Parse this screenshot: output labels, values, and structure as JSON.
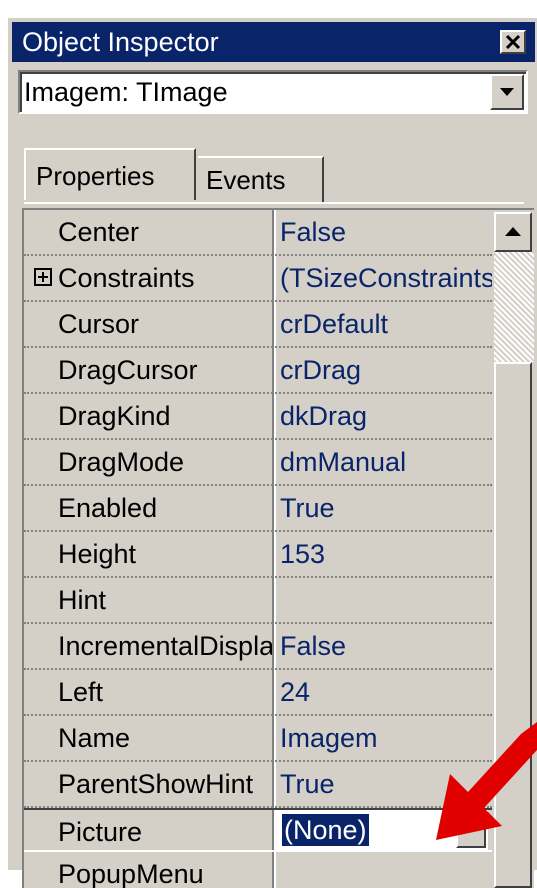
{
  "window": {
    "title": "Object Inspector",
    "close_glyph": "x"
  },
  "object_selector": {
    "value": "Imagem: TImage"
  },
  "tabs": [
    {
      "label": "Properties",
      "active": true
    },
    {
      "label": "Events",
      "active": false
    }
  ],
  "properties": [
    {
      "name": "Center",
      "value": "False",
      "expandable": false
    },
    {
      "name": "Constraints",
      "value": "(TSizeConstraints)",
      "expandable": true
    },
    {
      "name": "Cursor",
      "value": "crDefault",
      "expandable": false
    },
    {
      "name": "DragCursor",
      "value": "crDrag",
      "expandable": false
    },
    {
      "name": "DragKind",
      "value": "dkDrag",
      "expandable": false
    },
    {
      "name": "DragMode",
      "value": "dmManual",
      "expandable": false
    },
    {
      "name": "Enabled",
      "value": "True",
      "expandable": false
    },
    {
      "name": "Height",
      "value": "153",
      "expandable": false
    },
    {
      "name": "Hint",
      "value": "",
      "expandable": false
    },
    {
      "name": "IncrementalDisplay",
      "value": "False",
      "expandable": false
    },
    {
      "name": "Left",
      "value": "24",
      "expandable": false
    },
    {
      "name": "Name",
      "value": "Imagem",
      "expandable": false
    },
    {
      "name": "ParentShowHint",
      "value": "True",
      "expandable": false
    },
    {
      "name": "Picture",
      "value": "(None)",
      "expandable": false,
      "selected": true
    },
    {
      "name": "PopupMenu",
      "value": "",
      "expandable": false
    }
  ],
  "colors": {
    "titlebar": "#0a246a",
    "face": "#d4d0c8",
    "value_text": "#0a246a",
    "arrow": "#e00000"
  },
  "icons": [
    "close-icon",
    "dropdown-arrow-icon",
    "expand-plus-icon",
    "ellipsis-button",
    "scroll-up-icon",
    "red-arrow-pointer"
  ]
}
